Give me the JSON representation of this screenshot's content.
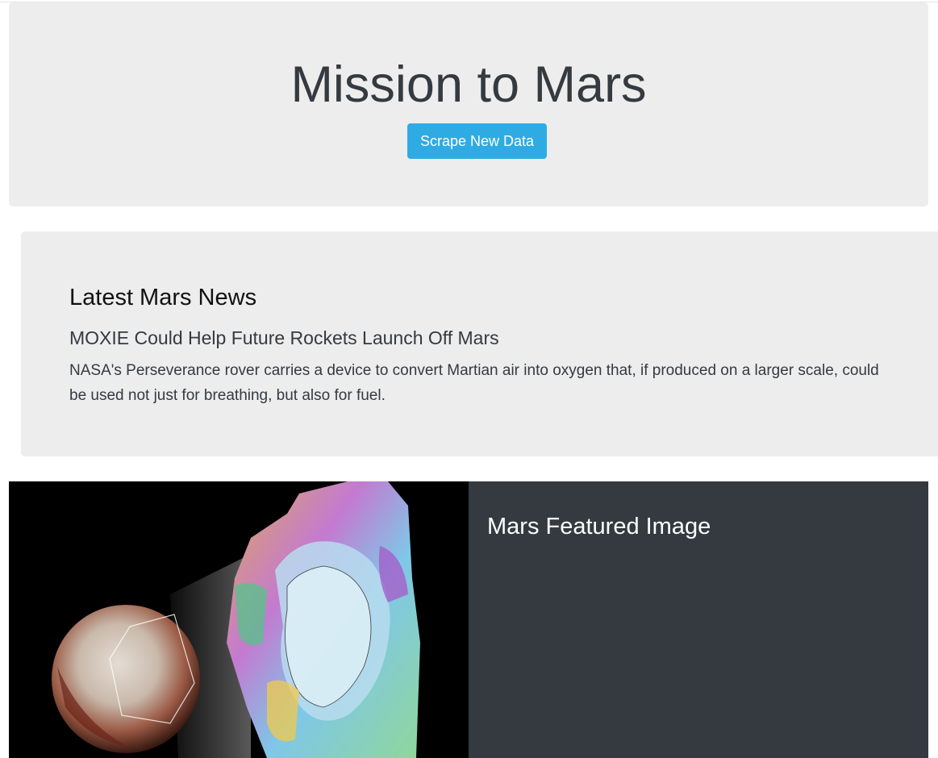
{
  "header": {
    "title": "Mission to Mars",
    "scrape_button_label": "Scrape New Data"
  },
  "news": {
    "section_title": "Latest Mars News",
    "headline": "MOXIE Could Help Future Rockets Launch Off Mars",
    "teaser": "NASA's Perseverance rover carries a device to convert Martian air into oxygen that, if produced on a larger scale, could be used not just for breathing, but also for fuel."
  },
  "featured": {
    "section_title": "Mars Featured Image"
  },
  "colors": {
    "accent_button": "#2fabe3",
    "panel_bg": "#ededed",
    "dark_panel": "#343a40"
  }
}
